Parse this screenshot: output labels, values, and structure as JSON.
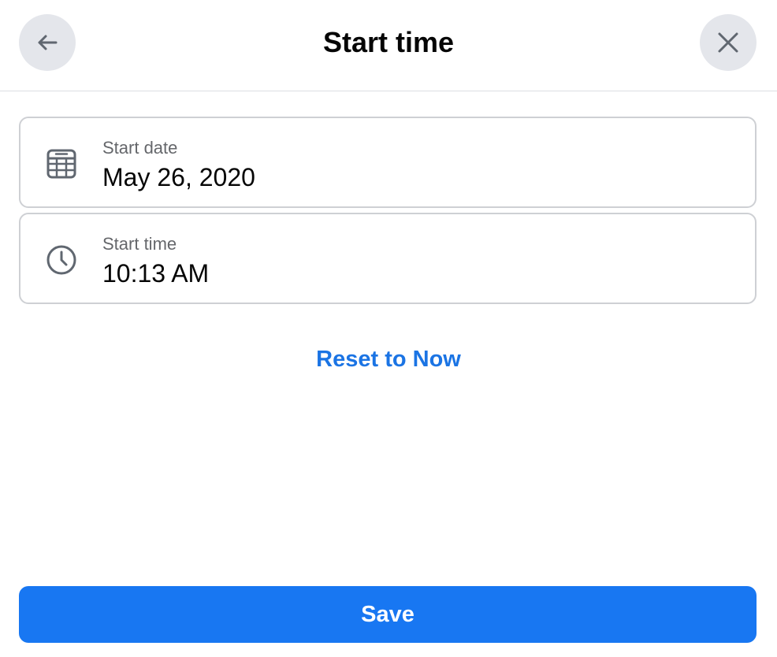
{
  "header": {
    "title": "Start time",
    "back_icon": "arrow-left-icon",
    "close_icon": "close-icon"
  },
  "fields": {
    "start_date": {
      "label": "Start date",
      "value": "May 26, 2020",
      "icon": "calendar-icon"
    },
    "start_time": {
      "label": "Start time",
      "value": "10:13 AM",
      "icon": "clock-icon"
    }
  },
  "actions": {
    "reset_label": "Reset to Now",
    "save_label": "Save"
  },
  "colors": {
    "accent": "#1877f2",
    "link": "#1b74e4",
    "circle_button_bg": "#e4e6eb",
    "border": "#ced0d4",
    "secondary_text": "#65676b"
  }
}
